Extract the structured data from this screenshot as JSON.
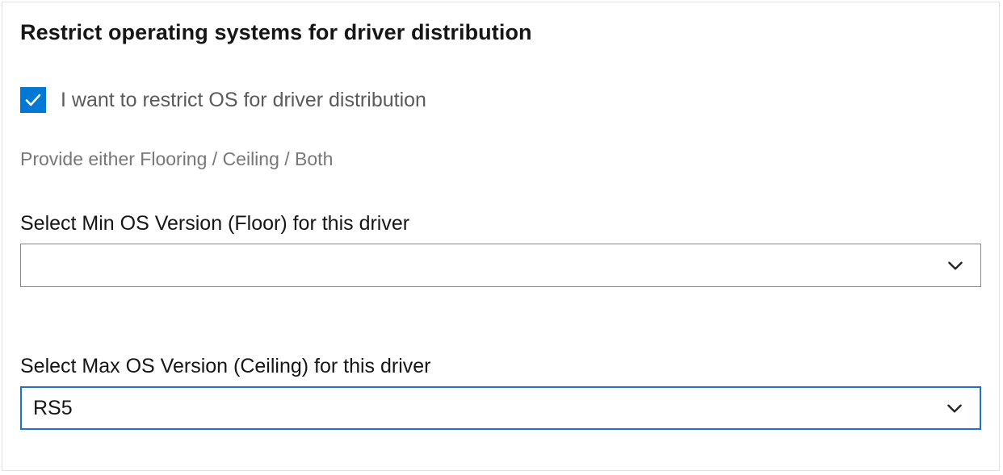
{
  "title": "Restrict operating systems for driver distribution",
  "checkbox": {
    "label": "I want to restrict OS for driver distribution",
    "checked": true
  },
  "hint": "Provide either Flooring / Ceiling / Both",
  "min_os": {
    "label": "Select Min OS Version (Floor) for this driver",
    "value": ""
  },
  "max_os": {
    "label": "Select Max OS Version (Ceiling) for this driver",
    "value": "RS5"
  },
  "colors": {
    "accent": "#0078d4",
    "focus_border": "#2072c9"
  }
}
